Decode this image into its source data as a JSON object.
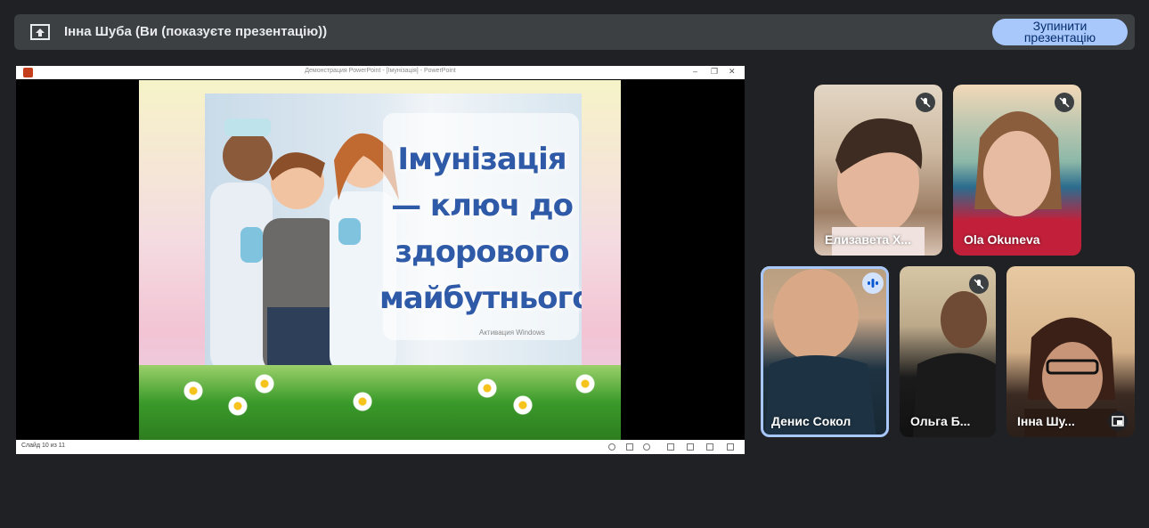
{
  "banner": {
    "title": "Інна Шуба (Ви (показуєте презентацію))",
    "stop_button": "Зупинити презентацію",
    "icon": "present-screen-icon"
  },
  "powerpoint": {
    "window_title": "Демонстрация PowerPoint - [Імунізація] - PowerPoint",
    "status": "Слайд 10 из 11",
    "slide": {
      "title": "Імунізація — ключ до здорового майбутнього",
      "watermark": "Активация Windows"
    }
  },
  "participants": [
    {
      "name": "Елизавета Х...",
      "mic": "muted",
      "icon": "mic-off-icon"
    },
    {
      "name": "Ola Okuneva",
      "mic": "muted",
      "icon": "mic-off-icon"
    },
    {
      "name": "Денис Сокол",
      "mic": "speaking",
      "icon": "audio-level-icon"
    },
    {
      "name": "Ольга Б...",
      "mic": "muted",
      "icon": "mic-off-icon"
    },
    {
      "name": "Інна Шу...",
      "mic": "self",
      "icon": "picture-in-picture-icon"
    }
  ],
  "colors": {
    "background": "#202124",
    "banner": "#3c4043",
    "stop_button": "#a8c7fa",
    "active_speaker": "#a8c7fa"
  }
}
